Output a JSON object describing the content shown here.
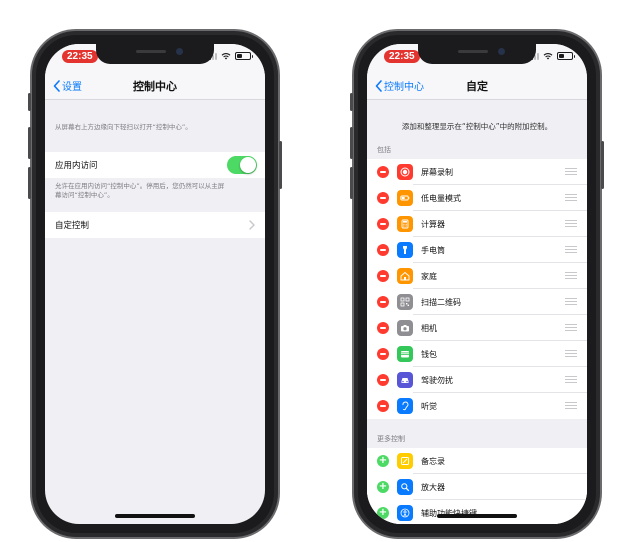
{
  "left_phone": {
    "status": {
      "time": "22:35"
    },
    "nav": {
      "back_label": "设置",
      "title": "控制中心"
    },
    "description": "从屏幕右上方边缘向下轻扫以打开“控制中心”。",
    "access_row": {
      "label": "应用内访问",
      "toggle_on": true
    },
    "access_footer": "允许在应用内访问“控制中心”。停用后，您仍然可以从主屏幕访问“控制中心”。",
    "customize_row": {
      "label": "自定控制"
    }
  },
  "right_phone": {
    "status": {
      "time": "22:35"
    },
    "nav": {
      "back_label": "控制中心",
      "title": "自定"
    },
    "description": "添加和整理显示在“控制中心”中的附加控制。",
    "include_header": "包括",
    "included": [
      {
        "label": "屏幕录制",
        "icon": "screen-record-icon",
        "color": "#ff3b30"
      },
      {
        "label": "低电量模式",
        "icon": "low-power-icon",
        "color": "#ff9500"
      },
      {
        "label": "计算器",
        "icon": "calculator-icon",
        "color": "#ff9500"
      },
      {
        "label": "手电筒",
        "icon": "flashlight-icon",
        "color": "#0a7aff"
      },
      {
        "label": "家庭",
        "icon": "home-icon",
        "color": "#ff9500"
      },
      {
        "label": "扫描二维码",
        "icon": "qr-code-icon",
        "color": "#8e8e93"
      },
      {
        "label": "相机",
        "icon": "camera-icon",
        "color": "#8e8e93"
      },
      {
        "label": "钱包",
        "icon": "wallet-icon",
        "color": "#34c759"
      },
      {
        "label": "驾驶勿扰",
        "icon": "car-icon",
        "color": "#5856d6"
      },
      {
        "label": "听觉",
        "icon": "ear-icon",
        "color": "#0a7aff"
      }
    ],
    "more_header": "更多控制",
    "more": [
      {
        "label": "备忘录",
        "icon": "notes-icon",
        "color": "#ffcc00"
      },
      {
        "label": "放大器",
        "icon": "magnifier-icon",
        "color": "#0a7aff"
      },
      {
        "label": "辅助功能快捷键",
        "icon": "accessibility-icon",
        "color": "#0a7aff"
      }
    ]
  },
  "colors": {
    "accent": "#0a7aff",
    "toggle_on": "#4cd964",
    "remove": "#ff3b30",
    "add": "#4cd964",
    "time_pill": "#e3342f"
  }
}
